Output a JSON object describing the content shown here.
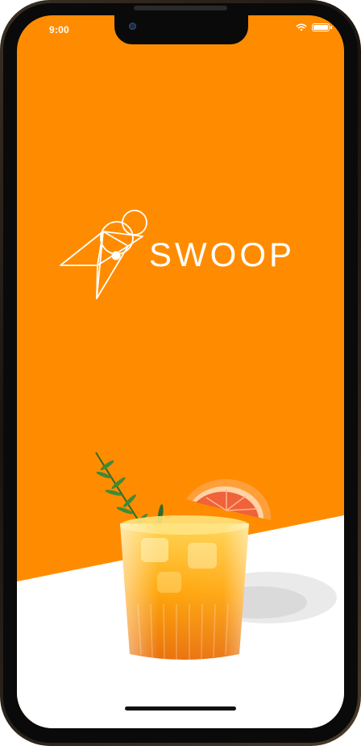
{
  "status_bar": {
    "time": "9:00",
    "wifi_icon": "wifi-icon",
    "battery_icon": "battery-icon"
  },
  "brand": {
    "name": "SWOOP",
    "logo_icon": "bird-logo-icon"
  },
  "hero": {
    "image": "orange-cocktail-drink"
  },
  "colors": {
    "accent": "#ff8c00",
    "background_bottom": "#ffffff",
    "text_on_accent": "#ffffff"
  }
}
